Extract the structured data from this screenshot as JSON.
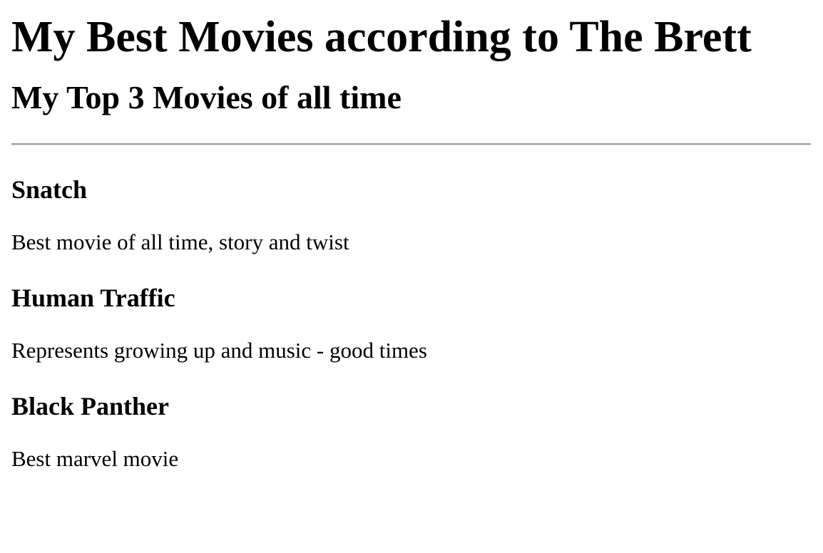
{
  "page": {
    "title": "My Best Movies according to The Brett",
    "subtitle": "My Top 3 Movies of all time"
  },
  "movies": [
    {
      "title": "Snatch",
      "description": "Best movie of all time, story and twist"
    },
    {
      "title": "Human Traffic",
      "description": "Represents growing up and music - good times"
    },
    {
      "title": "Black Panther",
      "description": "Best marvel movie"
    }
  ]
}
